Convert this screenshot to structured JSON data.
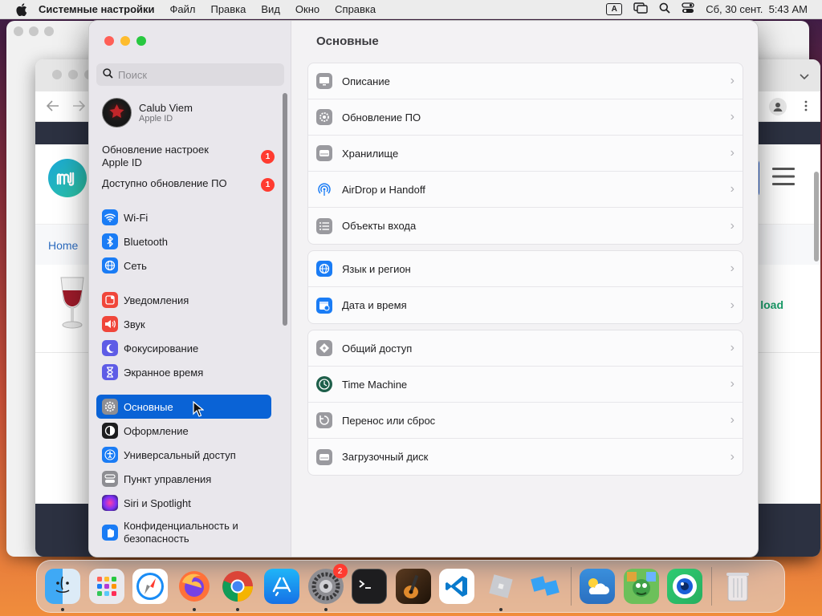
{
  "menubar": {
    "app_name": "Системные настройки",
    "menus": [
      "Файл",
      "Правка",
      "Вид",
      "Окно",
      "Справка"
    ],
    "input_indicator": "A",
    "datetime": "Сб, 30 сент.  5:43 AM"
  },
  "browser_bg": {
    "breadcrumb_home": "Home",
    "download_partial": "load"
  },
  "settings": {
    "search_placeholder": "Поиск",
    "account": {
      "name": "Calub Viem",
      "sub": "Apple ID"
    },
    "notices": [
      {
        "label": "Обновление настроек Apple ID",
        "badge": "1"
      },
      {
        "label": "Доступно обновление ПО",
        "badge": "1"
      }
    ],
    "sidebar": [
      {
        "label": "Wi‑Fi",
        "icon": "wifi-icon",
        "color": "#1a7cf5"
      },
      {
        "label": "Bluetooth",
        "icon": "bluetooth-icon",
        "color": "#1a7cf5"
      },
      {
        "label": "Сеть",
        "icon": "globe-icon",
        "color": "#1a7cf5"
      },
      {
        "label": "Уведомления",
        "icon": "bell-icon",
        "color": "#f0463a"
      },
      {
        "label": "Звук",
        "icon": "speaker-icon",
        "color": "#f0463a"
      },
      {
        "label": "Фокусирование",
        "icon": "moon-icon",
        "color": "#5e5ce6"
      },
      {
        "label": "Экранное время",
        "icon": "hourglass-icon",
        "color": "#5e5ce6"
      },
      {
        "label": "Основные",
        "icon": "gear-icon",
        "color": "#8e8e93"
      },
      {
        "label": "Оформление",
        "icon": "appearance-icon",
        "color": "#1d1d1f"
      },
      {
        "label": "Универсальный доступ",
        "icon": "accessibility-icon",
        "color": "#1a7cf5"
      },
      {
        "label": "Пункт управления",
        "icon": "control-center-icon",
        "color": "#8e8e93"
      },
      {
        "label": "Siri и Spotlight",
        "icon": "siri-icon",
        "color": "#b33ad6"
      },
      {
        "label": "Конфиденциальность и безопасность",
        "icon": "hand-icon",
        "color": "#1a7cf5"
      }
    ],
    "main_title": "Основные",
    "groups": [
      [
        {
          "label": "Описание",
          "icon": "display-icon"
        },
        {
          "label": "Обновление ПО",
          "icon": "gear-badge-icon"
        },
        {
          "label": "Хранилище",
          "icon": "drive-icon"
        },
        {
          "label": "AirDrop и Handoff",
          "icon": "airdrop-icon"
        },
        {
          "label": "Объекты входа",
          "icon": "list-icon"
        }
      ],
      [
        {
          "label": "Язык и регион",
          "icon": "globe-icon"
        },
        {
          "label": "Дата и время",
          "icon": "calendar-clock-icon"
        }
      ],
      [
        {
          "label": "Общий доступ",
          "icon": "sharing-icon"
        },
        {
          "label": "Time Machine",
          "icon": "time-machine-icon"
        },
        {
          "label": "Перенос или сброс",
          "icon": "reset-icon"
        },
        {
          "label": "Загрузочный диск",
          "icon": "startup-disk-icon"
        }
      ]
    ]
  },
  "dock": {
    "apps": [
      "finder-icon",
      "launchpad-icon",
      "safari-icon",
      "firefox-icon",
      "chrome-icon",
      "app-store-icon",
      "system-settings-icon",
      "terminal-icon",
      "garageband-icon",
      "vscode-icon",
      "roblox-icon",
      "roblox-studio-icon"
    ],
    "settings_badge": "2",
    "extra": [
      "weather-icon",
      "game-icon",
      "camera-icon",
      "trash-icon"
    ]
  }
}
